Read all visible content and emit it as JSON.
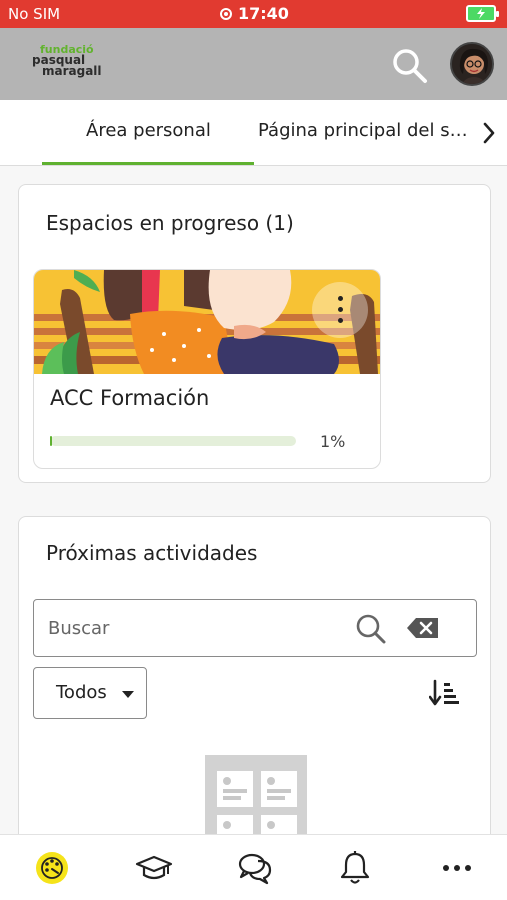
{
  "status_bar": {
    "carrier": "No SIM",
    "time": "17:40"
  },
  "header": {
    "logo_lines": [
      "fundació",
      "pasqual",
      "maragall"
    ],
    "search_icon": "search-icon",
    "avatar": "user-avatar"
  },
  "tabs": {
    "items": [
      {
        "label": "Área personal",
        "active": true
      },
      {
        "label": "Página principal del si..."
      }
    ],
    "next_icon": "chevron-right-icon"
  },
  "progress_section": {
    "title": "Espacios en progreso (1)",
    "course": {
      "name": "ACC Formación",
      "progress": 1,
      "progress_label": "1%",
      "menu_icon": "more-vertical-icon"
    }
  },
  "upcoming_section": {
    "title": "Próximas actividades",
    "search": {
      "placeholder": "Buscar",
      "value": ""
    },
    "filter": {
      "selected": "Todos"
    },
    "sort_icon": "sort-descending-icon"
  },
  "bottom_nav": {
    "items": [
      {
        "icon": "dashboard-palette-icon",
        "active": true
      },
      {
        "icon": "graduation-cap-icon"
      },
      {
        "icon": "chat-bubbles-icon"
      },
      {
        "icon": "bell-icon"
      },
      {
        "icon": "more-horizontal-icon"
      }
    ]
  },
  "colors": {
    "status_bar": "#e13a30",
    "app_bar": "#b4b4b4",
    "accent_green": "#5fb130",
    "active_nav": "#f5e31a"
  }
}
